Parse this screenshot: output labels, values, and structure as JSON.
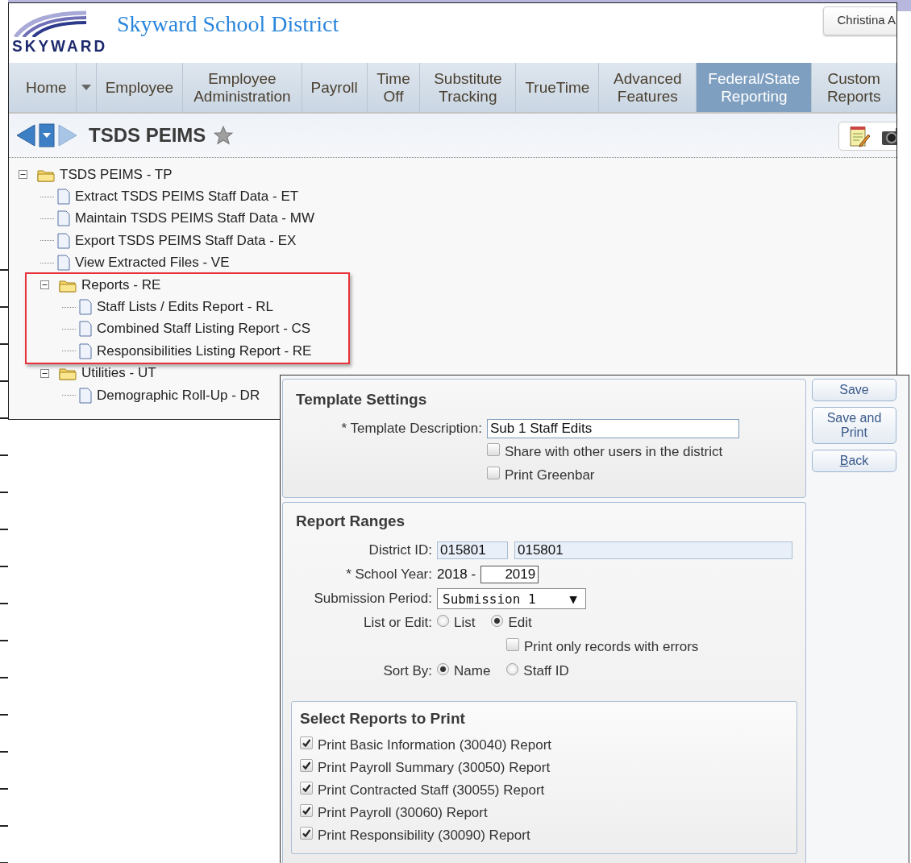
{
  "header": {
    "logo_text": "SKYWARD",
    "site_title": "Skyward School District",
    "user_button": "Christina A"
  },
  "nav": [
    {
      "kind": "tab",
      "label": "Home",
      "selected": false
    },
    {
      "kind": "menu"
    },
    {
      "kind": "tab",
      "label": "Employee",
      "selected": false
    },
    {
      "kind": "tab",
      "label": "Employee Administration",
      "selected": false
    },
    {
      "kind": "tab",
      "label": "Payroll",
      "selected": false
    },
    {
      "kind": "tab",
      "label": "Time Off",
      "selected": false
    },
    {
      "kind": "tab",
      "label": "Substitute Tracking",
      "selected": false
    },
    {
      "kind": "tab",
      "label": "TrueTime",
      "selected": false
    },
    {
      "kind": "tab",
      "label": "Advanced Features",
      "selected": false
    },
    {
      "kind": "tab",
      "label": "Federal/State Reporting",
      "selected": true
    },
    {
      "kind": "tab",
      "label": "Custom Reports",
      "selected": false
    }
  ],
  "breadcrumb": {
    "title": "TSDS PEIMS",
    "favorite": false
  },
  "tree": [
    {
      "kind": "folder",
      "label": "TSDS PEIMS - TP",
      "expanded": true,
      "highlighted": false,
      "children": [
        {
          "kind": "page",
          "label": "Extract TSDS PEIMS Staff Data - ET"
        },
        {
          "kind": "page",
          "label": "Maintain TSDS PEIMS Staff Data - MW"
        },
        {
          "kind": "page",
          "label": "Export TSDS PEIMS Staff Data - EX"
        },
        {
          "kind": "page",
          "label": "View Extracted Files - VE"
        },
        {
          "kind": "folder",
          "label": "Reports - RE",
          "expanded": true,
          "highlighted": true,
          "children": [
            {
              "kind": "page",
              "label": "Staff Lists / Edits Report - RL"
            },
            {
              "kind": "page",
              "label": "Combined Staff Listing Report - CS"
            },
            {
              "kind": "page",
              "label": "Responsibilities Listing Report - RE"
            }
          ]
        },
        {
          "kind": "folder",
          "label": "Utilities - UT",
          "expanded": true,
          "highlighted": false,
          "children": [
            {
              "kind": "page",
              "label": "Demographic Roll-Up - DR"
            }
          ]
        }
      ]
    }
  ],
  "template_settings": {
    "title": "Template Settings",
    "description": {
      "label": "* Template Description:",
      "value": "Sub 1 Staff Edits"
    },
    "options": [
      {
        "label": "Share with other users in the district",
        "checked": false
      },
      {
        "label": "Print Greenbar",
        "checked": false
      }
    ]
  },
  "report_ranges": {
    "title": "Report Ranges",
    "district_id": {
      "label": "District ID:",
      "from": "015801",
      "to": "015801"
    },
    "school_year": {
      "label": "* School Year:",
      "start": "2018 -",
      "end": "2019"
    },
    "submission_period": {
      "label": "Submission Period:",
      "value": "Submission 1",
      "arrow": "▼"
    },
    "list_or_edit": {
      "label": "List or Edit:",
      "options": [
        {
          "label": "List",
          "selected": false
        },
        {
          "label": "Edit",
          "selected": true
        }
      ]
    },
    "errors_only": {
      "label": "Print only records with errors",
      "checked": false
    },
    "sort_by": {
      "label": "Sort By:",
      "options": [
        {
          "label": "Name",
          "selected": true
        },
        {
          "label": "Staff ID",
          "selected": false
        }
      ]
    },
    "select_reports": {
      "title": "Select Reports to Print",
      "items": [
        {
          "label": "Print Basic Information (30040) Report",
          "checked": true
        },
        {
          "label": "Print Payroll Summary (30050) Report",
          "checked": true
        },
        {
          "label": "Print Contracted Staff (30055) Report",
          "checked": true
        },
        {
          "label": "Print Payroll (30060) Report",
          "checked": true
        },
        {
          "label": "Print Responsibility (30090) Report",
          "checked": true
        }
      ]
    }
  },
  "buttons": [
    {
      "label": "Save",
      "mnemonic": false
    },
    {
      "label": "Save and Print",
      "mnemonic": false
    },
    {
      "label": "Back",
      "mnemonic": true
    }
  ]
}
